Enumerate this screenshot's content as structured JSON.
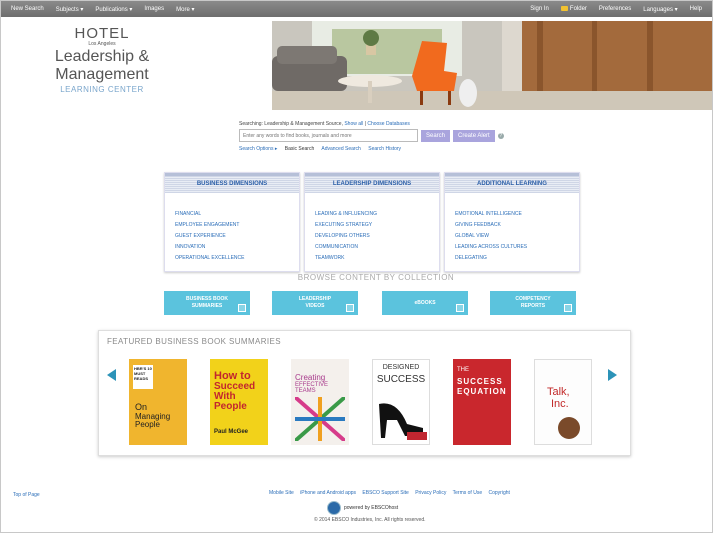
{
  "topbar": {
    "left": [
      "New Search",
      "Subjects ▾",
      "Publications ▾",
      "Images",
      "More ▾"
    ],
    "sign_in": "Sign In",
    "folder": "Folder",
    "preferences": "Preferences",
    "languages": "Languages ▾",
    "help": "Help"
  },
  "logo": {
    "hotel": "HOTEL",
    "city": "Los Angeles",
    "title": "Leadership & Management",
    "subtitle": "LEARNING CENTER"
  },
  "search": {
    "searching_prefix": "Searching: Leadership & Management Source,",
    "show_all": "Show all",
    "choose_databases": "Choose Databases",
    "placeholder": "Enter any words to find books, journals and more",
    "search_button": "Search",
    "create_alert_button": "Create Alert",
    "help": "?",
    "search_options": "Search Options ▸",
    "basic_search": "Basic Search",
    "advanced_search": "Advanced Search",
    "search_history": "Search History"
  },
  "dimensions": [
    {
      "title": "BUSINESS DIMENSIONS",
      "items": [
        "FINANCIAL",
        "EMPLOYEE ENGAGEMENT",
        "GUEST EXPERIENCE",
        "INNOVATION",
        "OPERATIONAL EXCELLENCE"
      ]
    },
    {
      "title": "LEADERSHIP DIMENSIONS",
      "items": [
        "LEADING & INFLUENCING",
        "EXECUTING STRATEGY",
        "DEVELOPING OTHERS",
        "COMMUNICATION",
        "TEAMWORK"
      ]
    },
    {
      "title": "ADDITIONAL LEARNING",
      "items": [
        "EMOTIONAL INTELLIGENCE",
        "GIVING FEEDBACK",
        "GLOBAL VIEW",
        "LEADING ACROSS CULTURES",
        "DELEGATING"
      ]
    }
  ],
  "browse": {
    "title": "BROWSE CONTENT BY COLLECTION",
    "collections": [
      {
        "line1": "BUSINESS BOOK",
        "line2": "SUMMARIES"
      },
      {
        "line1": "LEADERSHIP",
        "line2": "VIDEOS"
      },
      {
        "line1": "eBOOKS",
        "line2": ""
      },
      {
        "line1": "COMPETENCY",
        "line2": "REPORTS"
      }
    ]
  },
  "featured": {
    "title": "FEATURED BUSINESS BOOK SUMMARIES",
    "books": [
      {
        "top": "HBR'S 10 MUST READS",
        "title1": "On",
        "title2": "Managing People",
        "bg": "#f0b52e"
      },
      {
        "title1": "How to",
        "title2": "Succeed With People",
        "author": "Paul McGee",
        "bg": "#f2d21a"
      },
      {
        "title1": "Creating",
        "title2": "EFFECTIVE TEAMS",
        "bg": "#f4f0ec"
      },
      {
        "title1": "DESIGNED",
        "title2": "SUCCESS",
        "bg": "#ffffff"
      },
      {
        "title1": "THE",
        "title2": "SUCCESS EQUATION",
        "bg": "#c9272d"
      },
      {
        "title1": "Talk,",
        "title2": "Inc.",
        "bg": "#fdfdfd"
      }
    ]
  },
  "footer": {
    "links": [
      "Mobile Site",
      "iPhone and Android apps",
      "EBSCO Support Site",
      "Privacy Policy",
      "Terms of Use",
      "Copyright"
    ],
    "top_of_page": "Top of Page",
    "powered_by": "powered by EBSCOhost",
    "copyright": "© 2014 EBSCO Industries, Inc. All rights reserved."
  },
  "colors": {
    "accent": "#5bc3dd",
    "link": "#2a6db8",
    "search_button": "#a9a4dd",
    "topbar": "#7a7a7a"
  }
}
